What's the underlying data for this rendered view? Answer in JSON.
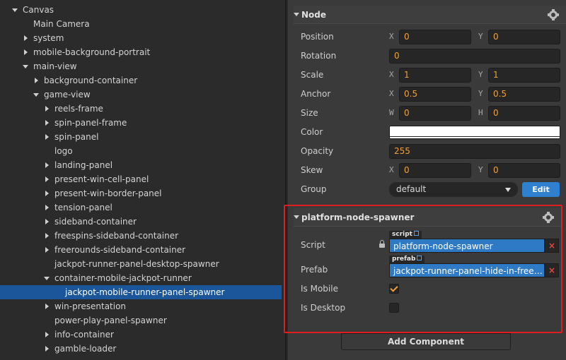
{
  "hierarchy": {
    "items": [
      {
        "label": "Canvas",
        "depth": 0,
        "arrow": "down"
      },
      {
        "label": "Main Camera",
        "depth": 1,
        "arrow": "none"
      },
      {
        "label": "system",
        "depth": 1,
        "arrow": "right"
      },
      {
        "label": "mobile-background-portrait",
        "depth": 1,
        "arrow": "right"
      },
      {
        "label": "main-view",
        "depth": 1,
        "arrow": "down"
      },
      {
        "label": "background-container",
        "depth": 2,
        "arrow": "right"
      },
      {
        "label": "game-view",
        "depth": 2,
        "arrow": "down"
      },
      {
        "label": "reels-frame",
        "depth": 3,
        "arrow": "right"
      },
      {
        "label": "spin-panel-frame",
        "depth": 3,
        "arrow": "right"
      },
      {
        "label": "spin-panel",
        "depth": 3,
        "arrow": "right"
      },
      {
        "label": "logo",
        "depth": 3,
        "arrow": "none"
      },
      {
        "label": "landing-panel",
        "depth": 3,
        "arrow": "right"
      },
      {
        "label": "present-win-cell-panel",
        "depth": 3,
        "arrow": "right"
      },
      {
        "label": "present-win-border-panel",
        "depth": 3,
        "arrow": "right"
      },
      {
        "label": "tension-panel",
        "depth": 3,
        "arrow": "right"
      },
      {
        "label": "sideband-container",
        "depth": 3,
        "arrow": "right"
      },
      {
        "label": "freespins-sideband-container",
        "depth": 3,
        "arrow": "right"
      },
      {
        "label": "freerounds-sideband-container",
        "depth": 3,
        "arrow": "right"
      },
      {
        "label": "jackpot-runner-panel-desktop-spawner",
        "depth": 3,
        "arrow": "none"
      },
      {
        "label": "container-mobile-jackpot-runner",
        "depth": 3,
        "arrow": "down"
      },
      {
        "label": "jackpot-mobile-runner-panel-spawner",
        "depth": 4,
        "arrow": "none",
        "selected": true
      },
      {
        "label": "win-presentation",
        "depth": 3,
        "arrow": "right"
      },
      {
        "label": "power-play-panel-spawner",
        "depth": 3,
        "arrow": "none"
      },
      {
        "label": "info-container",
        "depth": 3,
        "arrow": "right"
      },
      {
        "label": "gamble-loader",
        "depth": 3,
        "arrow": "right"
      }
    ]
  },
  "node": {
    "title": "Node",
    "position": {
      "label": "Position",
      "x_axis": "X",
      "y_axis": "Y",
      "x": "0",
      "y": "0"
    },
    "rotation": {
      "label": "Rotation",
      "value": "0"
    },
    "scale": {
      "label": "Scale",
      "x_axis": "X",
      "y_axis": "Y",
      "x": "1",
      "y": "1"
    },
    "anchor": {
      "label": "Anchor",
      "x_axis": "X",
      "y_axis": "Y",
      "x": "0.5",
      "y": "0.5"
    },
    "size": {
      "label": "Size",
      "w_axis": "W",
      "h_axis": "H",
      "w": "0",
      "h": "0"
    },
    "color": {
      "label": "Color",
      "value": "#ffffff"
    },
    "opacity": {
      "label": "Opacity",
      "value": "255"
    },
    "skew": {
      "label": "Skew",
      "x_axis": "X",
      "y_axis": "Y",
      "x": "0",
      "y": "0"
    },
    "group": {
      "label": "Group",
      "value": "default",
      "edit_label": "Edit"
    }
  },
  "component": {
    "title": "platform-node-spawner",
    "script": {
      "label": "Script",
      "tag": "script",
      "value": "platform-node-spawner",
      "clear": "×"
    },
    "prefab": {
      "label": "Prefab",
      "tag": "prefab",
      "value": "jackpot-runner-panel-hide-in-freespins",
      "clear": "×"
    },
    "is_mobile": {
      "label": "Is Mobile",
      "checked": true
    },
    "is_desktop": {
      "label": "Is Desktop",
      "checked": false
    }
  },
  "add_component_label": "Add Component",
  "colors": {
    "selection": "#1a5699",
    "accent_value": "#f0a13c",
    "asset_field": "#2f7ac4",
    "highlight_outline": "#e01e1e"
  }
}
